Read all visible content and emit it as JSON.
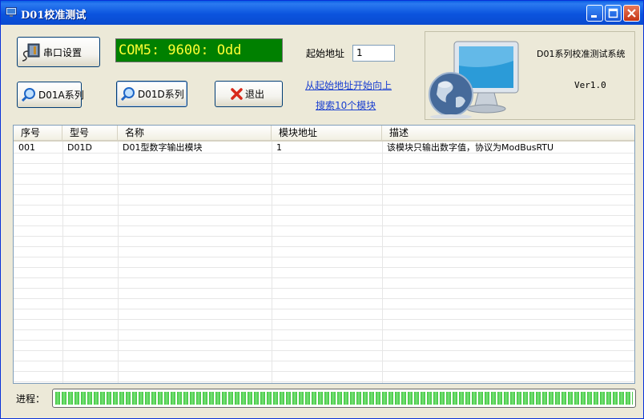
{
  "window": {
    "title": "D01校准测试",
    "controls": {
      "minimize_icon": "minimize-icon",
      "maximize_icon": "maximize-icon",
      "close_icon": "close-icon"
    }
  },
  "toolbar": {
    "serial_settings_label": "串口设置",
    "d01a_label": "D01A系列",
    "d01d_label": "D01D系列",
    "exit_label": "退出"
  },
  "status": {
    "port_display": "COM5: 9600: Odd"
  },
  "address": {
    "label": "起始地址",
    "value": "1",
    "link_line1": "从起始地址开始向上",
    "link_line2": "搜索10个模块"
  },
  "info_panel": {
    "system_name": "D01系列校准测试系统",
    "version": "Ver1.0"
  },
  "table": {
    "columns": [
      "序号",
      "型号",
      "名称",
      "模块地址",
      "描述"
    ],
    "rows": [
      [
        "001",
        "D01D",
        "D01型数字输出模块",
        "1",
        "该模块只输出数字值，协议为ModBusRTU"
      ]
    ]
  },
  "progress": {
    "label": "进程：",
    "value": 1.0
  },
  "colors": {
    "titlebar": "#0a54de",
    "lcd_background": "#008000",
    "lcd_text": "#ffff33",
    "link": "#1a3fd0",
    "progress_fill": "#3cc43c"
  }
}
